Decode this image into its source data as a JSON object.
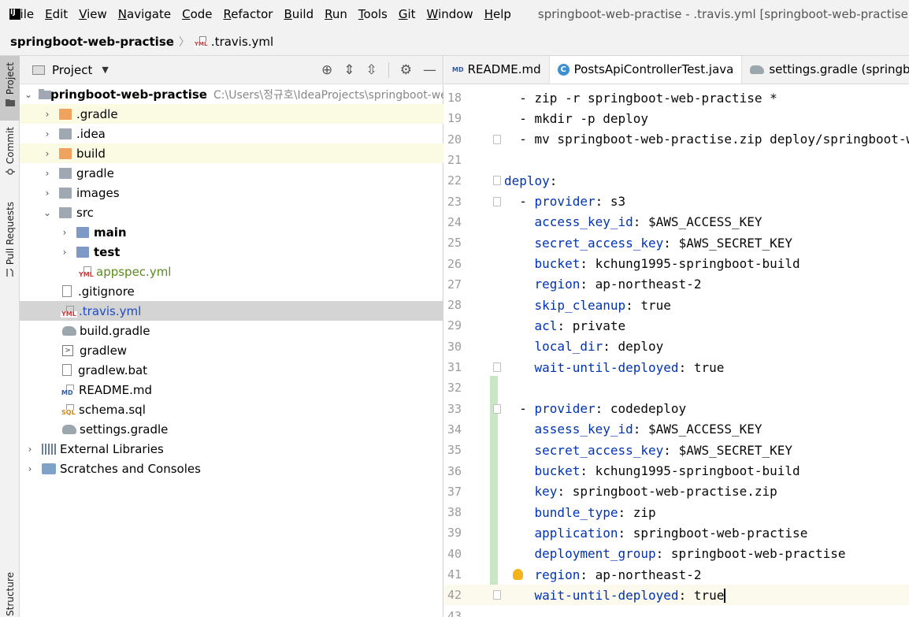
{
  "menubar": {
    "items": [
      {
        "label": "File",
        "u": "F",
        "rest": "ile"
      },
      {
        "label": "Edit",
        "u": "E",
        "rest": "dit"
      },
      {
        "label": "View",
        "u": "V",
        "rest": "iew"
      },
      {
        "label": "Navigate",
        "u": "N",
        "rest": "avigate"
      },
      {
        "label": "Code",
        "u": "C",
        "rest": "ode"
      },
      {
        "label": "Refactor",
        "u": "R",
        "rest": "efactor"
      },
      {
        "label": "Build",
        "u": "B",
        "rest": "uild"
      },
      {
        "label": "Run",
        "u": "R",
        "rest": "un"
      },
      {
        "label": "Tools",
        "u": "T",
        "rest": "ools"
      },
      {
        "label": "Git",
        "u": "G",
        "rest": "it"
      },
      {
        "label": "Window",
        "u": "W",
        "rest": "indow"
      },
      {
        "label": "Help",
        "u": "H",
        "rest": "elp"
      }
    ],
    "window_title": "springboot-web-practise - .travis.yml [springboot-web-practise]"
  },
  "breadcrumb": {
    "project": "springboot-web-practise",
    "file": ".travis.yml"
  },
  "toolstripe": {
    "project": "Project",
    "commit": "Commit",
    "pull_requests": "Pull Requests",
    "structure": "Structure"
  },
  "project_panel": {
    "title": "Project",
    "root_name": "springboot-web-practise",
    "root_path": "C:\\Users\\정규호\\IdeaProjects\\springboot-web-practise",
    "items": [
      {
        "label": ".gradle"
      },
      {
        "label": ".idea"
      },
      {
        "label": "build"
      },
      {
        "label": "gradle"
      },
      {
        "label": "images"
      },
      {
        "label": "src"
      },
      {
        "label": "main"
      },
      {
        "label": "test"
      },
      {
        "label": "appspec.yml"
      },
      {
        "label": ".gitignore"
      },
      {
        "label": ".travis.yml"
      },
      {
        "label": "build.gradle"
      },
      {
        "label": "gradlew"
      },
      {
        "label": "gradlew.bat"
      },
      {
        "label": "README.md"
      },
      {
        "label": "schema.sql"
      },
      {
        "label": "settings.gradle"
      },
      {
        "label": "External Libraries"
      },
      {
        "label": "Scratches and Consoles"
      }
    ]
  },
  "editor": {
    "tabs": [
      {
        "label": "README.md"
      },
      {
        "label": "PostsApiControllerTest.java"
      },
      {
        "label": "settings.gradle (springboot-web-practise)"
      }
    ],
    "lines": [
      {
        "n": "18",
        "k": "",
        "v": "  - zip -r springboot-web-practise *"
      },
      {
        "n": "19",
        "k": "",
        "v": "  - mkdir -p deploy"
      },
      {
        "n": "20",
        "k": "",
        "v": "  - mv springboot-web-practise.zip deploy/springboot-web-practise.zip"
      },
      {
        "n": "21",
        "k": "",
        "v": ""
      },
      {
        "n": "22",
        "k": "deploy",
        "v": ":"
      },
      {
        "n": "23",
        "k": "provider",
        "v": ": s3"
      },
      {
        "n": "24",
        "k": "access_key_id",
        "v": ": $AWS_ACCESS_KEY"
      },
      {
        "n": "25",
        "k": "secret_access_key",
        "v": ": $AWS_SECRET_KEY"
      },
      {
        "n": "26",
        "k": "bucket",
        "v": ": kchung1995-springboot-build"
      },
      {
        "n": "27",
        "k": "region",
        "v": ": ap-northeast-2"
      },
      {
        "n": "28",
        "k": "skip_cleanup",
        "v": ": true"
      },
      {
        "n": "29",
        "k": "acl",
        "v": ": private"
      },
      {
        "n": "30",
        "k": "local_dir",
        "v": ": deploy"
      },
      {
        "n": "31",
        "k": "wait-until-deployed",
        "v": ": true"
      },
      {
        "n": "32",
        "k": "",
        "v": ""
      },
      {
        "n": "33",
        "k": "provider",
        "v": ": codedeploy"
      },
      {
        "n": "34",
        "k": "assess_key_id",
        "v": ": $AWS_ACCESS_KEY"
      },
      {
        "n": "35",
        "k": "secret_access_key",
        "v": ": $AWS_SECRET_KEY"
      },
      {
        "n": "36",
        "k": "bucket",
        "v": ": kchung1995-springboot-build"
      },
      {
        "n": "37",
        "k": "key",
        "v": ": springboot-web-practise.zip"
      },
      {
        "n": "38",
        "k": "bundle_type",
        "v": ": zip"
      },
      {
        "n": "39",
        "k": "application",
        "v": ": springboot-web-practise"
      },
      {
        "n": "40",
        "k": "deployment_group",
        "v": ": springboot-web-practise"
      },
      {
        "n": "41",
        "k": "region",
        "v": ": ap-northeast-2"
      },
      {
        "n": "42",
        "k": "wait-until-deployed",
        "v": ": true"
      },
      {
        "n": "43",
        "k": "",
        "v": ""
      }
    ]
  }
}
